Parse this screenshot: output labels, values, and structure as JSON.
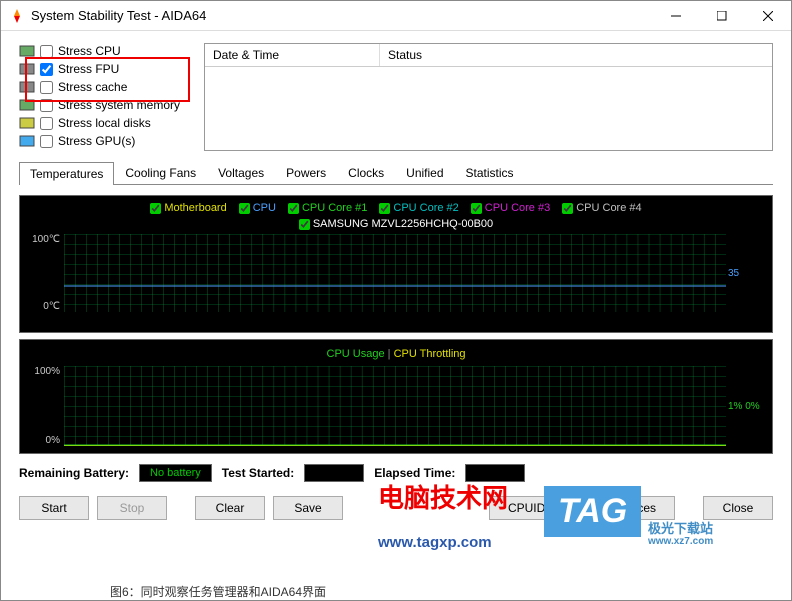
{
  "title": "System Stability Test - AIDA64",
  "stress_items": [
    {
      "label": "Stress CPU",
      "checked": false
    },
    {
      "label": "Stress FPU",
      "checked": true
    },
    {
      "label": "Stress cache",
      "checked": false
    },
    {
      "label": "Stress system memory",
      "checked": false
    },
    {
      "label": "Stress local disks",
      "checked": false
    },
    {
      "label": "Stress GPU(s)",
      "checked": false
    }
  ],
  "log_headers": {
    "col1": "Date & Time",
    "col2": "Status"
  },
  "tabs": [
    "Temperatures",
    "Cooling Fans",
    "Voltages",
    "Powers",
    "Clocks",
    "Unified",
    "Statistics"
  ],
  "active_tab": 0,
  "temp_legend": [
    {
      "label": "Motherboard",
      "color": "#e0e000"
    },
    {
      "label": "CPU",
      "color": "#4aa0ff"
    },
    {
      "label": "CPU Core #1",
      "color": "#20d020"
    },
    {
      "label": "CPU Core #2",
      "color": "#00c0c0"
    },
    {
      "label": "CPU Core #3",
      "color": "#d020d0"
    },
    {
      "label": "CPU Core #4",
      "color": "#c0c0c0"
    }
  ],
  "temp_legend2": [
    {
      "label": "SAMSUNG MZVL2256HCHQ-00B00",
      "color": "#fff"
    }
  ],
  "temp_y": {
    "max": "100℃",
    "min": "0℃"
  },
  "temp_side": "35",
  "usage_legend": {
    "a": "CPU Usage",
    "sep": "|",
    "b": "CPU Throttling"
  },
  "usage_y": {
    "max": "100%",
    "min": "0%"
  },
  "usage_side": "1% 0%",
  "status": {
    "battery_lbl": "Remaining Battery:",
    "battery_val": "No battery",
    "started_lbl": "Test Started:",
    "elapsed_lbl": "Elapsed Time:"
  },
  "buttons": {
    "start": "Start",
    "stop": "Stop",
    "clear": "Clear",
    "save": "Save",
    "cpuid": "CPUID",
    "prefs": "Preferences",
    "close": "Close"
  },
  "watermarks": {
    "wm1": "电脑技术网",
    "wm2": "www.tagxp.com",
    "wm3": "TAG",
    "wm4": "极光下载站",
    "wm5": "www.xz7.com"
  },
  "caption": "图6：同时观察任务管理器和AIDA64界面",
  "chart_data": [
    {
      "type": "line",
      "title": "Temperatures",
      "ylabel": "°C",
      "ylim": [
        0,
        100
      ],
      "series": [
        {
          "name": "Motherboard",
          "current": 35
        },
        {
          "name": "CPU",
          "current": 35
        },
        {
          "name": "CPU Core #1",
          "current": 35
        },
        {
          "name": "CPU Core #2",
          "current": 35
        },
        {
          "name": "CPU Core #3",
          "current": 35
        },
        {
          "name": "CPU Core #4",
          "current": 35
        },
        {
          "name": "SAMSUNG MZVL2256HCHQ-00B00",
          "current": 35
        }
      ]
    },
    {
      "type": "line",
      "title": "CPU Usage / Throttling",
      "ylabel": "%",
      "ylim": [
        0,
        100
      ],
      "series": [
        {
          "name": "CPU Usage",
          "current": 1
        },
        {
          "name": "CPU Throttling",
          "current": 0
        }
      ]
    }
  ]
}
